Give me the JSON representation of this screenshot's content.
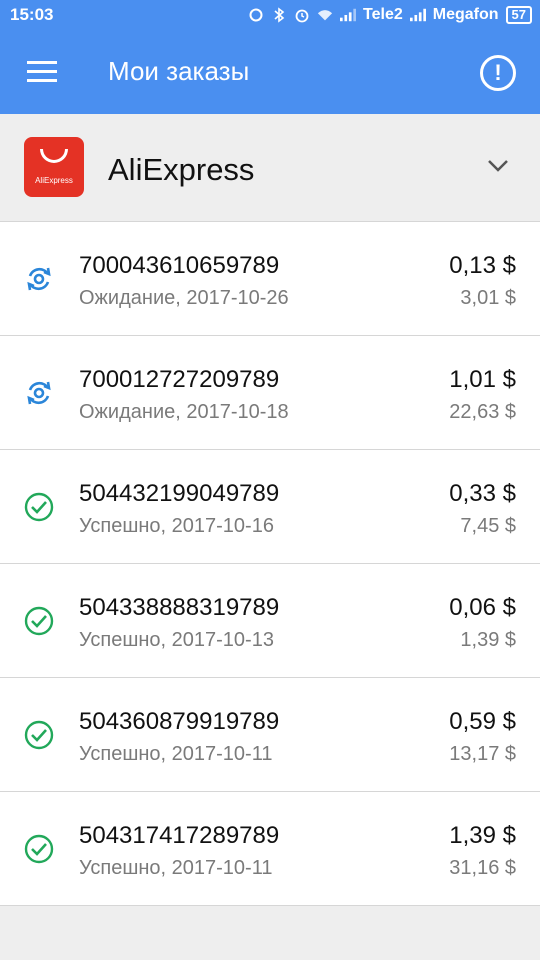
{
  "status_bar": {
    "time": "15:03",
    "carrier1": "Tele2",
    "carrier2": "Megafon",
    "battery": "57",
    "icons": [
      "sync-icon",
      "bluetooth-icon",
      "alarm-icon",
      "wifi-icon",
      "signal-icon",
      "signal-icon"
    ]
  },
  "app_bar": {
    "title": "Мои заказы",
    "menu_icon": "hamburger-menu-icon",
    "action_icon": "info-icon",
    "background": "#4a8ff0"
  },
  "store": {
    "name": "AliExpress",
    "logo_text": "AliExpress",
    "logo_color": "#e43225",
    "dropdown_icon": "chevron-down-icon"
  },
  "orders": [
    {
      "id": "700043610659789",
      "status": "Ожидание, 2017-10-26",
      "amount": "0,13  $",
      "total": "3,01  $",
      "icon": "sync-pending-icon",
      "icon_color": "#2b86d9"
    },
    {
      "id": "700012727209789",
      "status": "Ожидание, 2017-10-18",
      "amount": "1,01  $",
      "total": "22,63  $",
      "icon": "sync-pending-icon",
      "icon_color": "#2b86d9"
    },
    {
      "id": "504432199049789",
      "status": "Успешно, 2017-10-16",
      "amount": "0,33  $",
      "total": "7,45  $",
      "icon": "check-circle-icon",
      "icon_color": "#22a85a"
    },
    {
      "id": "504338888319789",
      "status": "Успешно, 2017-10-13",
      "amount": "0,06  $",
      "total": "1,39  $",
      "icon": "check-circle-icon",
      "icon_color": "#22a85a"
    },
    {
      "id": "504360879919789",
      "status": "Успешно, 2017-10-11",
      "amount": "0,59  $",
      "total": "13,17  $",
      "icon": "check-circle-icon",
      "icon_color": "#22a85a"
    },
    {
      "id": "504317417289789",
      "status": "Успешно, 2017-10-11",
      "amount": "1,39  $",
      "total": "31,16  $",
      "icon": "check-circle-icon",
      "icon_color": "#22a85a"
    }
  ]
}
